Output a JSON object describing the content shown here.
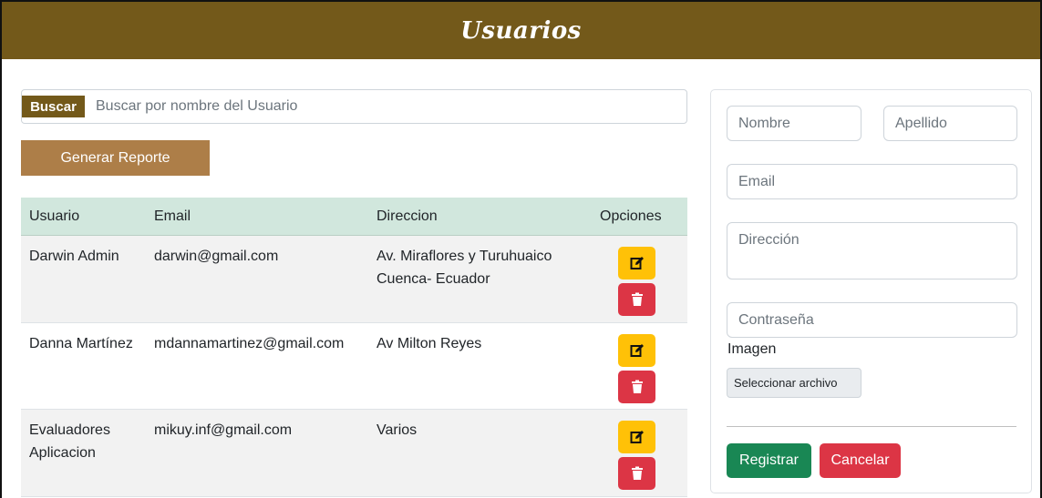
{
  "header": {
    "title": "Usuarios"
  },
  "search": {
    "button_label": "Buscar",
    "placeholder": "Buscar por nombre del Usuario"
  },
  "report_button": "Generar Reporte",
  "table": {
    "headers": [
      "Usuario",
      "Email",
      "Direccion",
      "Opciones"
    ],
    "rows": [
      {
        "user": "Darwin Admin",
        "email": "darwin@gmail.com",
        "address": "Av. Miraflores y Turuhuaico Cuenca- Ecuador"
      },
      {
        "user": "Danna Martínez",
        "email": "mdannamartinez@gmail.com",
        "address": "Av Milton Reyes"
      },
      {
        "user": "Evaluadores Aplicacion",
        "email": "mikuy.inf@gmail.com",
        "address": "Varios"
      }
    ],
    "edit_icon": "edit-icon",
    "delete_icon": "trash-icon"
  },
  "form": {
    "nombre_placeholder": "Nombre",
    "apellido_placeholder": "Apellido",
    "email_placeholder": "Email",
    "direccion_placeholder": "Dirección",
    "password_placeholder": "Contraseña",
    "image_label": "Imagen",
    "file_button": "Seleccionar archivo",
    "submit_label": "Registrar",
    "cancel_label": "Cancelar"
  },
  "colors": {
    "header": "#73591a",
    "report_button": "#ad7e48",
    "table_header": "#d1e7dd",
    "edit": "#ffc107",
    "delete": "#dc3545",
    "register": "#198754"
  }
}
